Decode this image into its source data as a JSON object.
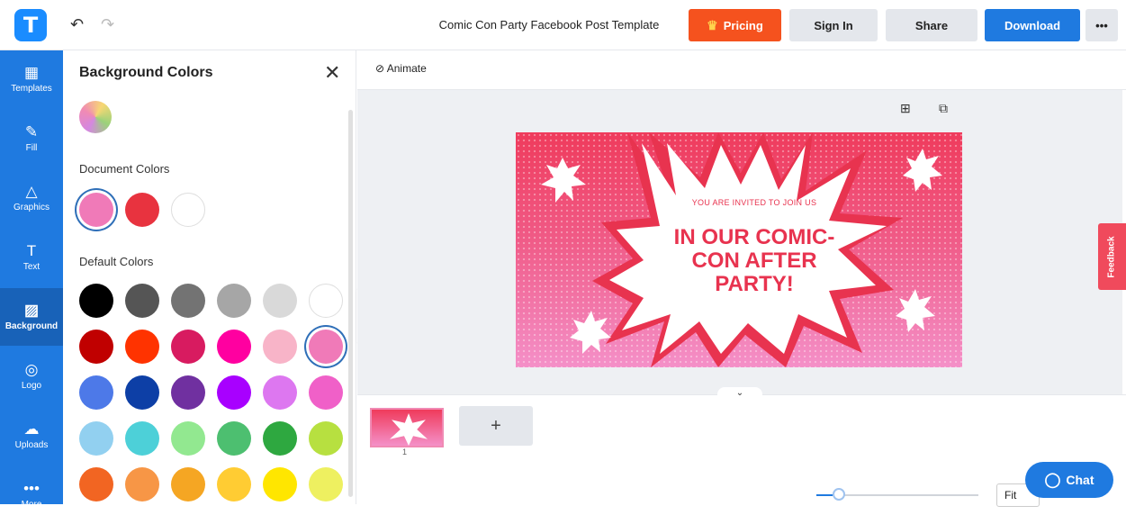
{
  "header": {
    "logo_letter": "T",
    "undo_icon": "↶",
    "redo_icon": "↷",
    "document_title": "Comic Con Party Facebook Post Template",
    "pricing_label": "Pricing",
    "signin_label": "Sign In",
    "share_label": "Share",
    "download_label": "Download",
    "more_label": "•••"
  },
  "sidebar": {
    "items": [
      {
        "label": "Templates",
        "icon": "▦"
      },
      {
        "label": "Fill",
        "icon": "✎"
      },
      {
        "label": "Graphics",
        "icon": "△"
      },
      {
        "label": "Text",
        "icon": "T"
      },
      {
        "label": "Background",
        "icon": "▨"
      },
      {
        "label": "Logo",
        "icon": "◎"
      },
      {
        "label": "Uploads",
        "icon": "☁"
      },
      {
        "label": "More",
        "icon": "•••"
      }
    ],
    "active": "Background"
  },
  "panel": {
    "title": "Background Colors",
    "close_icon": "✕",
    "document_colors_label": "Document Colors",
    "default_colors_label": "Default Colors",
    "document_colors": [
      "#f07ab8",
      "#e8333f",
      "#ffffff"
    ],
    "default_colors": [
      [
        "#000000",
        "#555555",
        "#737373",
        "#a6a6a6",
        "#d9d9d9",
        "#ffffff"
      ],
      [
        "#c00000",
        "#ff3300",
        "#d81b60",
        "#ff00a0",
        "#f8b4c8",
        "#f07ab8"
      ],
      [
        "#4d79e8",
        "#0d3fa6",
        "#7030a0",
        "#a800ff",
        "#dd77f0",
        "#f060c8"
      ],
      [
        "#92d0f0",
        "#4dd0d8",
        "#92e890",
        "#4dbf70",
        "#2ea840",
        "#b7e040"
      ],
      [
        "#f26522",
        "#f79646",
        "#f5a623",
        "#ffcc33",
        "#ffe600",
        "#eef060"
      ]
    ]
  },
  "toolbar": {
    "animate_label": "Animate",
    "add_icon": "⊞",
    "duplicate_icon": "⧉"
  },
  "design": {
    "invite_line": "YOU ARE INVITED TO JOIN US",
    "headline": "IN OUR COMIC-CON AFTER PARTY!",
    "colors": {
      "primary": "#e8334f",
      "bg_top": "#ef3b5c",
      "bg_bottom": "#f490c8"
    }
  },
  "pages": {
    "page_number": "1",
    "add_label": "+",
    "chevron": "⌄"
  },
  "zoom": {
    "fit_label": "Fit",
    "level": 0.1
  },
  "feedback_label": "Feedback",
  "chat_label": "Chat",
  "chat_icon": "◯"
}
